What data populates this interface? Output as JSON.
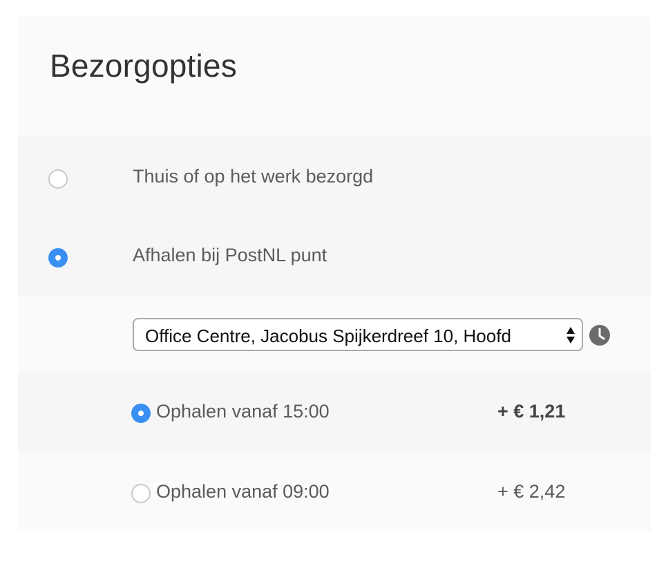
{
  "title": "Bezorgopties",
  "delivery_options": [
    {
      "label": "Thuis of op het werk bezorgd",
      "checked": false
    },
    {
      "label": "Afhalen bij PostNL punt",
      "checked": true
    }
  ],
  "pickup_location": {
    "selected": "Office Centre, Jacobus Spijkerdreef 10, Hoofd"
  },
  "pickup_times": [
    {
      "label": "Ophalen vanaf 15:00",
      "price": "+ € 1,21",
      "checked": true
    },
    {
      "label": "Ophalen vanaf 09:00",
      "price": "+ € 2,42",
      "checked": false
    }
  ],
  "icons": {
    "location_info": "clock-icon"
  },
  "colors": {
    "accent": "#3a8ff2",
    "panel": "#fafafa",
    "text": "#5b5b5b"
  }
}
